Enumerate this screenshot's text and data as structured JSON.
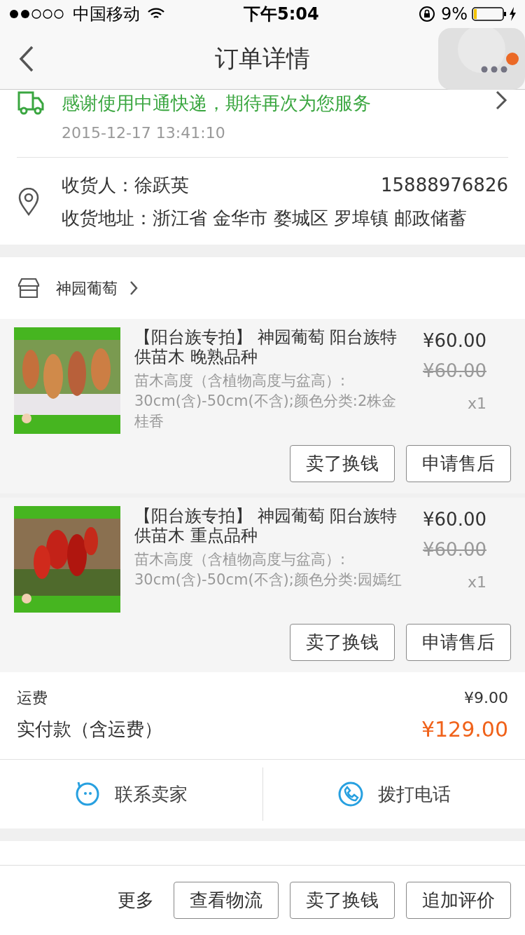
{
  "status_bar": {
    "carrier": "中国移动",
    "time": "下午5:04",
    "battery_text": "9%"
  },
  "nav": {
    "title": "订单详情"
  },
  "logistics": {
    "message": "感谢使用中通快递，期待再次为您服务",
    "time": "2015-12-17 13:41:10"
  },
  "address": {
    "receiver": "收货人：徐跃英",
    "phone": "15888976826",
    "address": "收货地址：浙江省 金华市 婺城区 罗埠镇 邮政储蓄"
  },
  "store": {
    "name": "神园葡萄"
  },
  "items": [
    {
      "title": "【阳台族专拍】 神园葡萄 阳台族特供苗木 晚熟品种",
      "spec": "苗木高度（含植物高度与盆高）: 30cm(含)-50cm(不含);颜色分类:2株金桂香",
      "price": "¥60.00",
      "original_price": "¥60.00",
      "quantity": "x1",
      "buttons": [
        "卖了换钱",
        "申请售后"
      ]
    },
    {
      "title": "【阳台族专拍】 神园葡萄 阳台族特供苗木 重点品种",
      "spec": "苗木高度（含植物高度与盆高）: 30cm(含)-50cm(不含);颜色分类:园嫣红",
      "price": "¥60.00",
      "original_price": "¥60.00",
      "quantity": "x1",
      "buttons": [
        "卖了换钱",
        "申请售后"
      ]
    }
  ],
  "totals": {
    "shipping_label": "运费",
    "shipping": "¥9.00",
    "paid_label": "实付款（含运费）",
    "paid": "¥129.00"
  },
  "contact": [
    {
      "kind": "chat",
      "label": "联系卖家"
    },
    {
      "kind": "phone",
      "label": "拨打电话"
    }
  ],
  "bottom_bar": {
    "more": "更多",
    "buttons": [
      "查看物流",
      "卖了换钱",
      "追加评价"
    ]
  }
}
